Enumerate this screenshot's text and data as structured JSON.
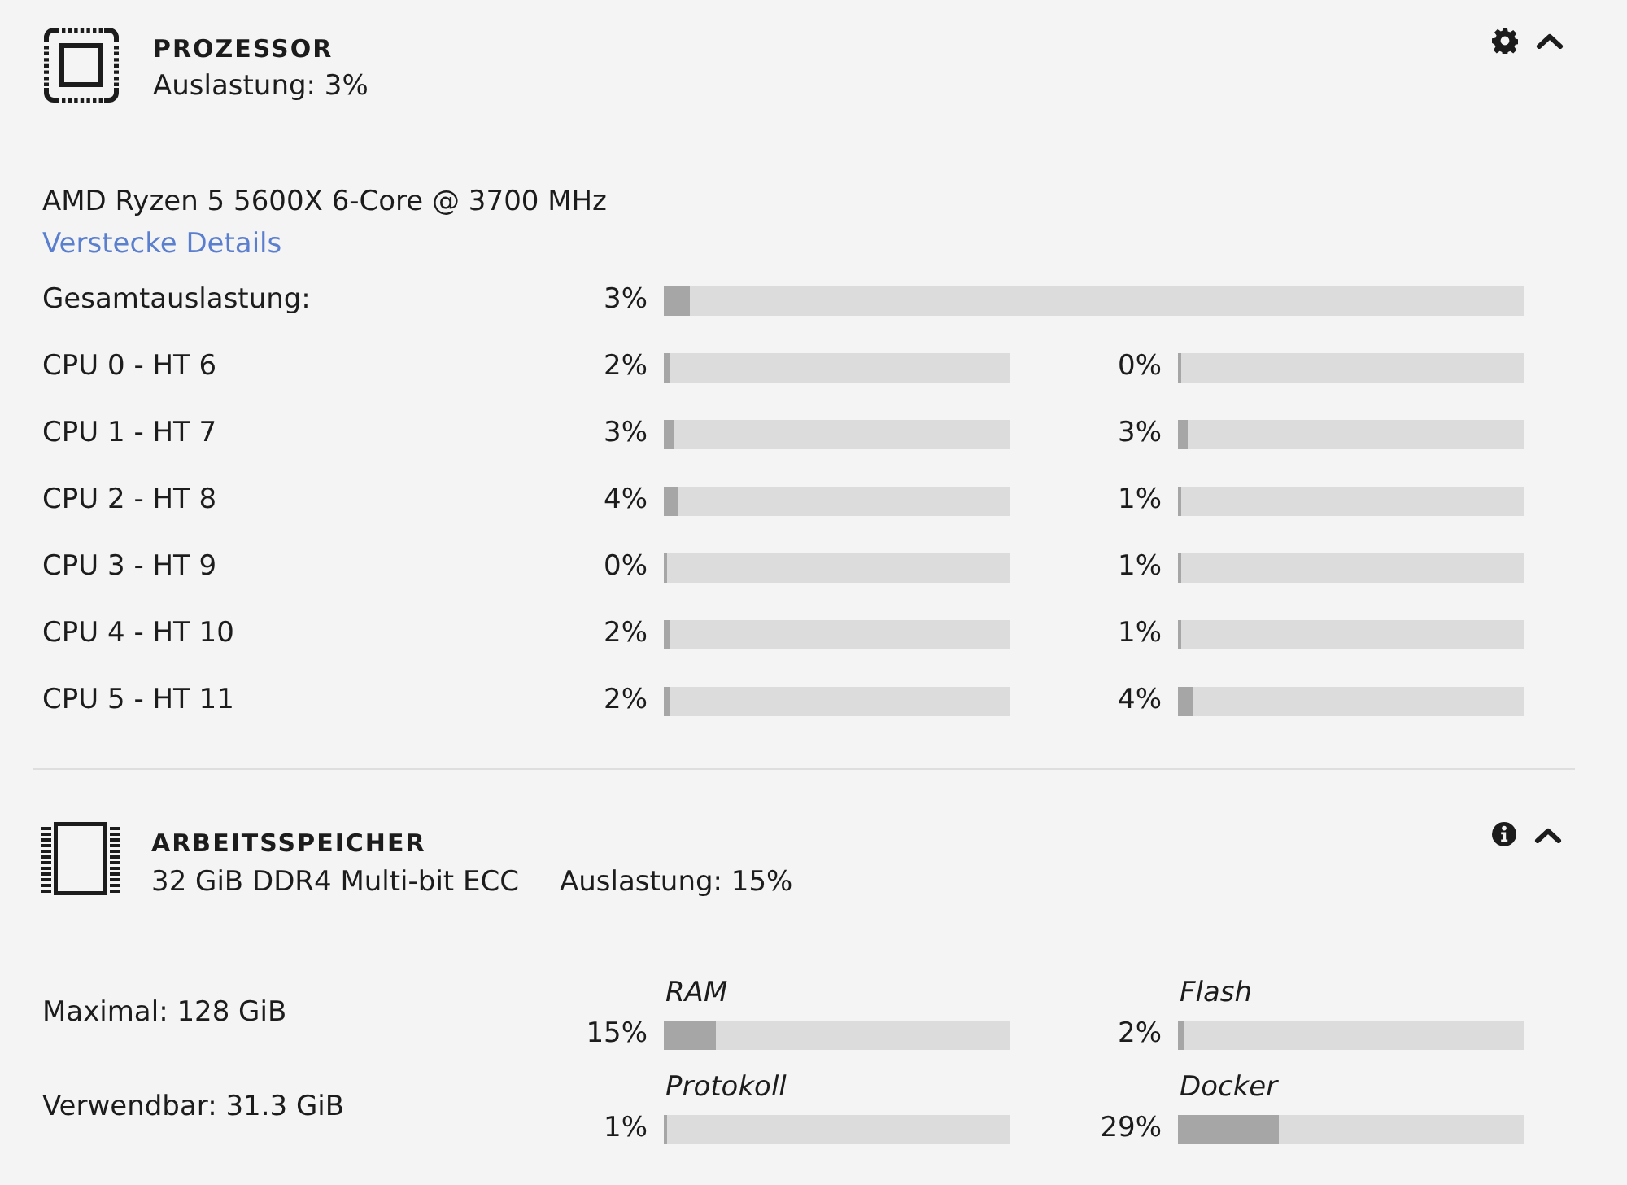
{
  "processor": {
    "title": "PROZESSOR",
    "usage": "Auslastung: 3%",
    "model": "AMD Ryzen 5 5600X 6-Core @ 3700 MHz",
    "details_link": "Verstecke Details",
    "total": {
      "label": "Gesamtauslastung:",
      "reading": "3%",
      "level": 0.03
    },
    "cores": [
      {
        "label": "CPU 0 - HT 6",
        "threads": [
          {
            "reading": "2%",
            "level": 0.02
          },
          {
            "reading": "0%",
            "level": 0
          }
        ]
      },
      {
        "label": "CPU 1 - HT 7",
        "threads": [
          {
            "reading": "3%",
            "level": 0.03
          },
          {
            "reading": "3%",
            "level": 0.03
          }
        ]
      },
      {
        "label": "CPU 2 - HT 8",
        "threads": [
          {
            "reading": "4%",
            "level": 0.04
          },
          {
            "reading": "1%",
            "level": 0.01
          }
        ]
      },
      {
        "label": "CPU 3 - HT 9",
        "threads": [
          {
            "reading": "0%",
            "level": 0
          },
          {
            "reading": "1%",
            "level": 0.01
          }
        ]
      },
      {
        "label": "CPU 4 - HT 10",
        "threads": [
          {
            "reading": "2%",
            "level": 0.02
          },
          {
            "reading": "1%",
            "level": 0.01
          }
        ]
      },
      {
        "label": "CPU 5 - HT 11",
        "threads": [
          {
            "reading": "2%",
            "level": 0.02
          },
          {
            "reading": "4%",
            "level": 0.04
          }
        ]
      }
    ]
  },
  "memory": {
    "title": "ARBEITSSPEICHER",
    "spec": "32 GiB DDR4 Multi-bit ECC",
    "usage": "Auslastung: 15%",
    "rows": [
      {
        "label": "Maximal: 128 GiB",
        "gauges": [
          {
            "name": "RAM",
            "reading": "15%",
            "level": 0.15
          },
          {
            "name": "Flash",
            "reading": "2%",
            "level": 0.02
          }
        ]
      },
      {
        "label": "Verwendbar: 31.3 GiB",
        "gauges": [
          {
            "name": "Protokoll",
            "reading": "1%",
            "level": 0.01
          },
          {
            "name": "Docker",
            "reading": "29%",
            "level": 0.29
          }
        ]
      }
    ]
  }
}
